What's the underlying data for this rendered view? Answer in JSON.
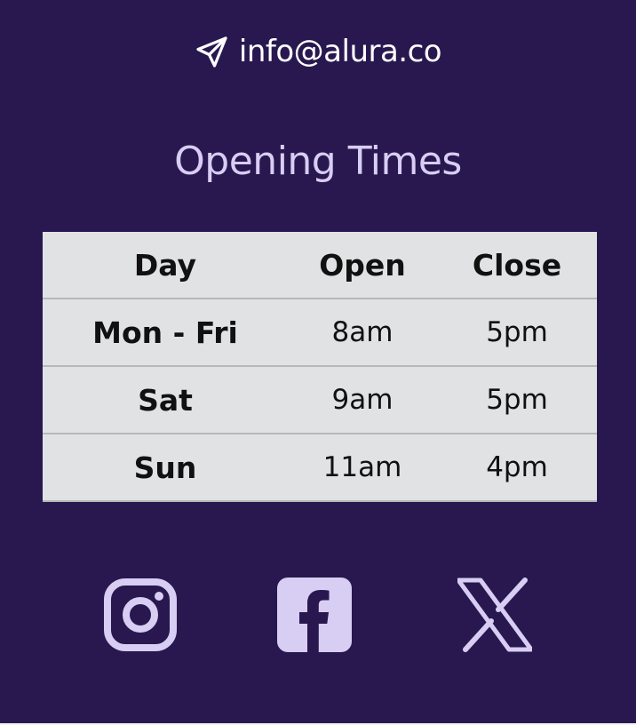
{
  "contact": {
    "icon": "paper-plane-icon",
    "email": "info@alura.co"
  },
  "hours": {
    "title": "Opening Times",
    "headers": [
      "Day",
      "Open",
      "Close"
    ],
    "rows": [
      {
        "day": "Mon - Fri",
        "open": "8am",
        "close": "5pm"
      },
      {
        "day": "Sat",
        "open": "9am",
        "close": "5pm"
      },
      {
        "day": "Sun",
        "open": "11am",
        "close": "4pm"
      }
    ]
  },
  "social": [
    {
      "icon": "instagram-icon"
    },
    {
      "icon": "facebook-icon"
    },
    {
      "icon": "x-twitter-icon"
    }
  ],
  "colors": {
    "background": "#28184f",
    "accent": "#d8cdf3",
    "table_background": "#e1e2e4",
    "table_border": "#b8b8ba"
  }
}
